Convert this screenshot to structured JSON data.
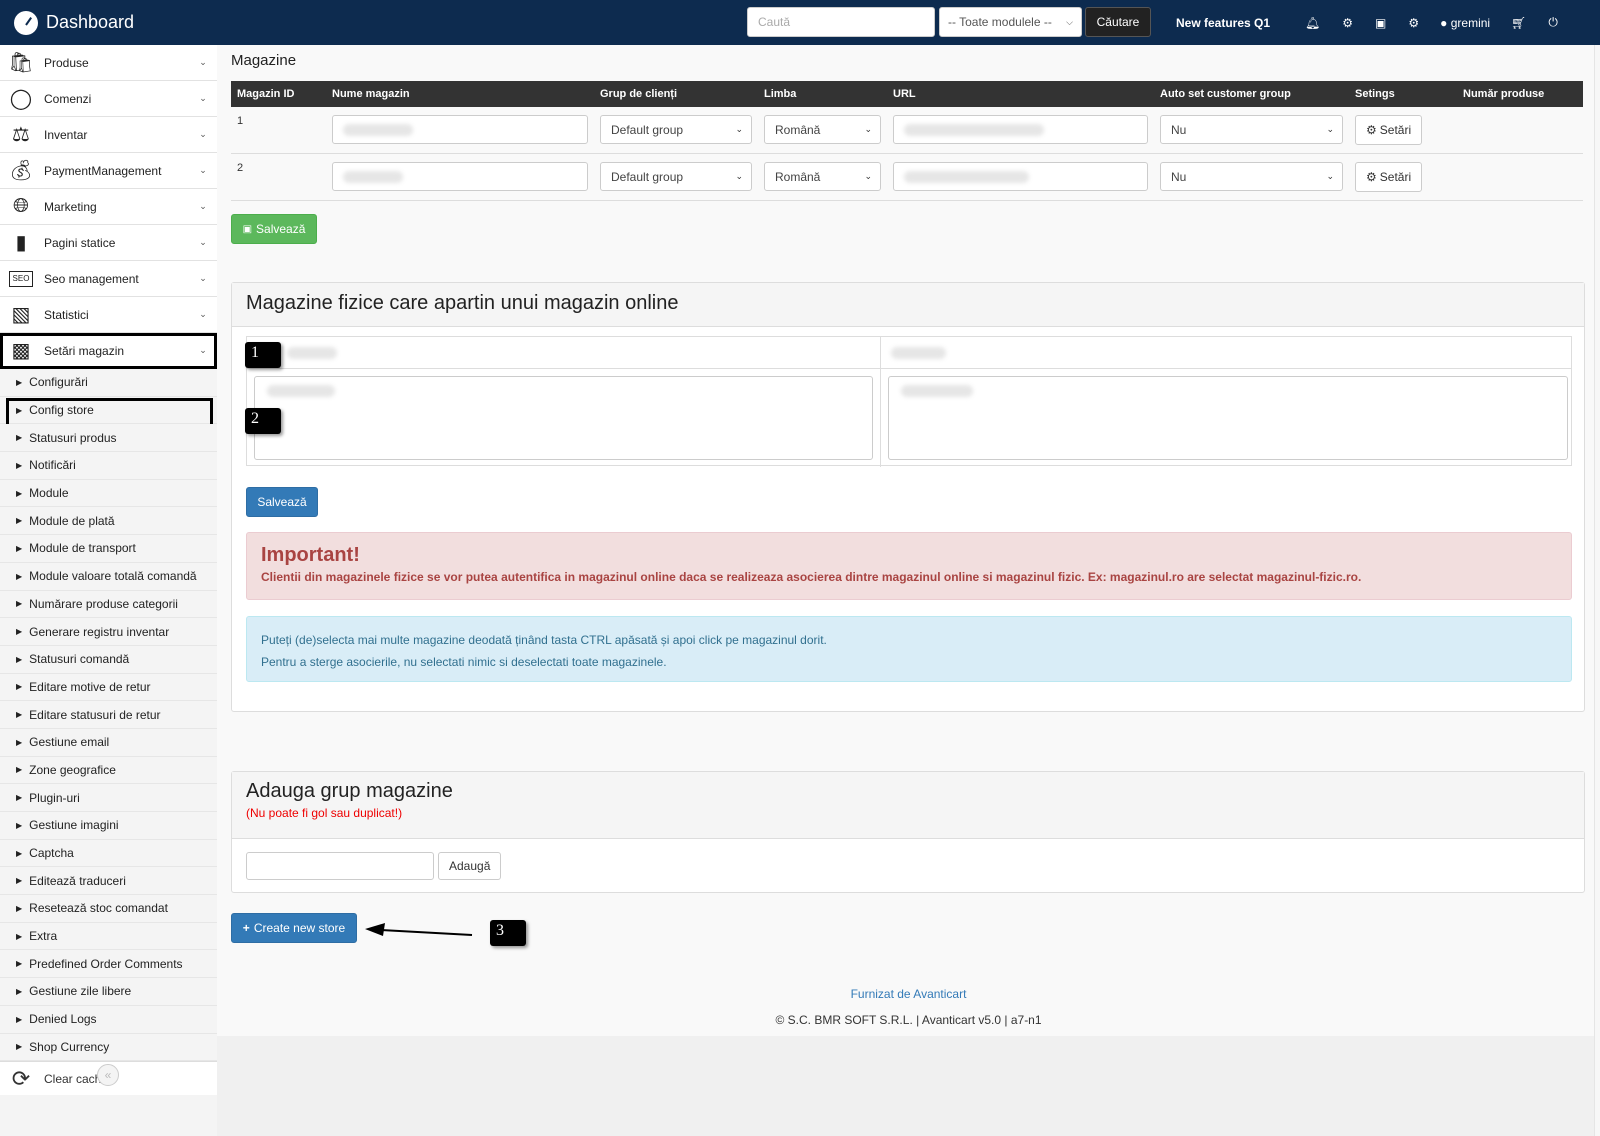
{
  "header": {
    "brand": "Dashboard",
    "search_placeholder": "Caută",
    "module_select": "-- Toate modulele --",
    "search_button": "Căutare",
    "new_features": "New features Q1",
    "user": "gremini"
  },
  "sidebar": {
    "items": [
      {
        "label": "Produse",
        "icon": "shopping-bags-icon"
      },
      {
        "label": "Comenzi",
        "icon": "coins-icon"
      },
      {
        "label": "Inventar",
        "icon": "scales-icon"
      },
      {
        "label": "PaymentManagement",
        "icon": "money-bag-icon"
      },
      {
        "label": "Marketing",
        "icon": "globe-icon"
      },
      {
        "label": "Pagini statice",
        "icon": "document-icon"
      },
      {
        "label": "Seo management",
        "icon": "seo-monitor-icon"
      },
      {
        "label": "Statistici",
        "icon": "bar-chart-icon"
      },
      {
        "label": "Setări magazin",
        "icon": "briefcase-icon"
      }
    ],
    "sub_items": [
      "Configurări",
      "Config store",
      "Statusuri produs",
      "Notificări",
      "Module",
      "Module de plată",
      "Module de transport",
      "Module valoare totală comandă",
      "Numărare produse categorii",
      "Generare registru inventar",
      "Statusuri comandă",
      "Editare motive de retur",
      "Editare statusuri de retur",
      "Gestiune email",
      "Zone geografice",
      "Plugin-uri",
      "Gestiune imagini",
      "Captcha",
      "Editează traduceri",
      "Resetează stoc comandat",
      "Extra",
      "Predefined Order Comments",
      "Gestiune zile libere",
      "Denied Logs",
      "Shop Currency"
    ],
    "clear_cache": "Clear cache"
  },
  "main": {
    "title": "Magazine",
    "table": {
      "headers": [
        "Magazin ID",
        "Nume magazin",
        "Grup de clienți",
        "Limba",
        "URL",
        "Auto set customer group",
        "Setings",
        "Număr produse"
      ],
      "rows": [
        {
          "id": "1",
          "group": "Default group",
          "lang": "Română",
          "auto": "Nu",
          "settings": "Setări"
        },
        {
          "id": "2",
          "group": "Default group",
          "lang": "Română",
          "auto": "Nu",
          "settings": "Setări"
        }
      ]
    },
    "save_button": "Salvează",
    "physical": {
      "title": "Magazine fizice care apartin unui magazin online",
      "save_button": "Salvează",
      "important_title": "Important!",
      "important_text": "Clientii din magazinele fizice se vor putea autentifica in magazinul online daca se realizeaza asocierea dintre magazinul online si magazinul fizic. Ex: magazinul.ro are selectat magazinul-fizic.ro.",
      "info_line1": "Puteți (de)selecta mai multe magazine deodată ținând tasta CTRL apăsată și apoi click pe magazinul dorit.",
      "info_line2": "Pentru a sterge asocierile, nu selectati nimic si deselectati toate magazinele."
    },
    "group": {
      "title": "Adauga grup magazine",
      "note": "(Nu poate fi gol sau duplicat!)",
      "add_button": "Adaugă"
    },
    "create_button": "Create new store",
    "markers": [
      "1",
      "2",
      "3"
    ],
    "footer_link": "Furnizat de Avanticart",
    "footer_copy": "© S.C. BMR SOFT S.R.L. | Avanticart v5.0 | a7-n1"
  }
}
